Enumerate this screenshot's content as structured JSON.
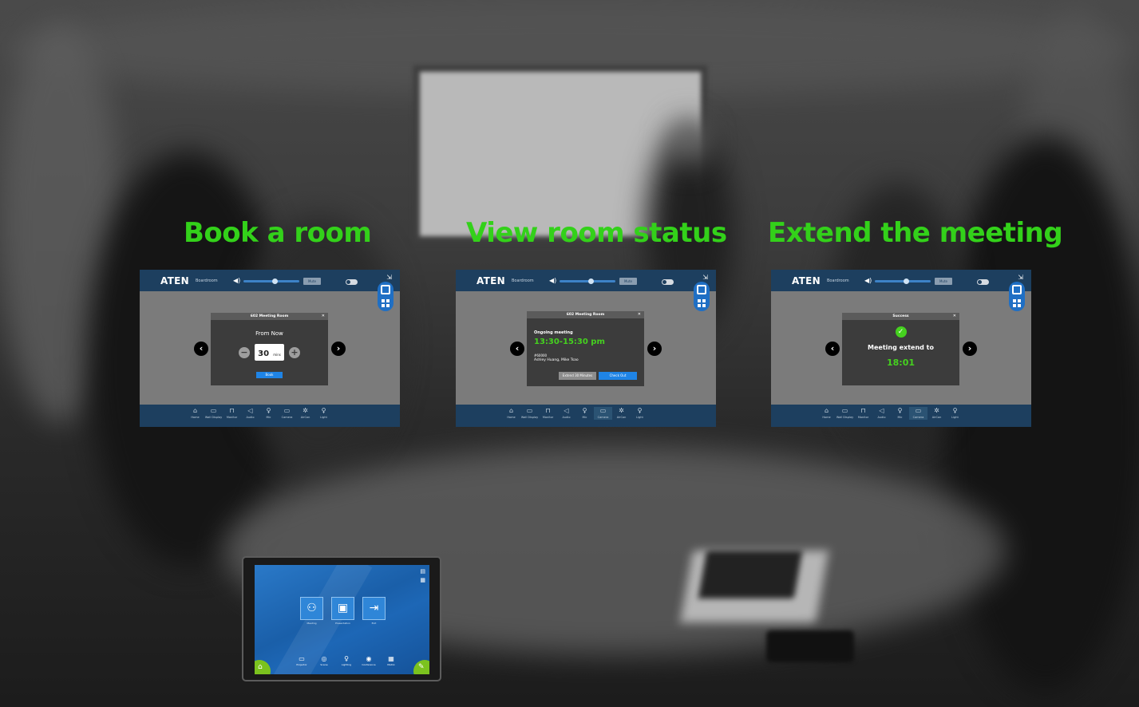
{
  "headings": {
    "book": "Book a room",
    "view": "View room status",
    "extend": "Extend the meeting"
  },
  "topbar": {
    "logo": "ATEN",
    "room": "Boardroom",
    "mute_label": "Mute",
    "volume_level": 0.55
  },
  "nav": [
    {
      "icon": "home-icon",
      "glyph": "⌂",
      "label": "Home"
    },
    {
      "icon": "wall-display-icon",
      "glyph": "▭",
      "label": "Wall Display"
    },
    {
      "icon": "monitor-icon",
      "glyph": "⊓",
      "label": "Monitor"
    },
    {
      "icon": "audio-icon",
      "glyph": "◁",
      "label": "Audio"
    },
    {
      "icon": "mic-icon",
      "glyph": "♀",
      "label": "Mic"
    },
    {
      "icon": "camera-icon",
      "glyph": "▭",
      "label": "Camera"
    },
    {
      "icon": "aircon-icon",
      "glyph": "✲",
      "label": "AirCon"
    },
    {
      "icon": "light-icon",
      "glyph": "♀",
      "label": "Light"
    }
  ],
  "book_dialog": {
    "title": "602 Meeting Room",
    "from": "From Now",
    "duration": "30",
    "unit": "mins",
    "book_button": "Book"
  },
  "status_dialog": {
    "title": "602 Meeting Room",
    "status": "Ongoing meeting",
    "time": "13:30-15:30 pm",
    "host": "#60000",
    "attendees": "Ashley Huang, Mike Tsao",
    "extend_button": "Extend 30 Minutes",
    "checkout_button": "Check Out"
  },
  "success_dialog": {
    "title": "Success",
    "message": "Meeting extend to",
    "time": "18:01"
  },
  "tablet": {
    "apps": [
      {
        "icon": "meeting-icon",
        "glyph": "⚇",
        "label": "Meeting"
      },
      {
        "icon": "presentation-icon",
        "glyph": "▣",
        "label": "Presentation"
      },
      {
        "icon": "exit-icon",
        "glyph": "⇥",
        "label": "Exit"
      }
    ],
    "nav": [
      {
        "icon": "projector-icon",
        "glyph": "▭",
        "label": "Projector"
      },
      {
        "icon": "scene-icon",
        "glyph": "◎",
        "label": "Scene"
      },
      {
        "icon": "lighting-icon",
        "glyph": "♀",
        "label": "Lighting"
      },
      {
        "icon": "conference-icon",
        "glyph": "◉",
        "label": "Conference"
      },
      {
        "icon": "matrix-icon",
        "glyph": "▦",
        "label": "Matrix"
      }
    ]
  }
}
